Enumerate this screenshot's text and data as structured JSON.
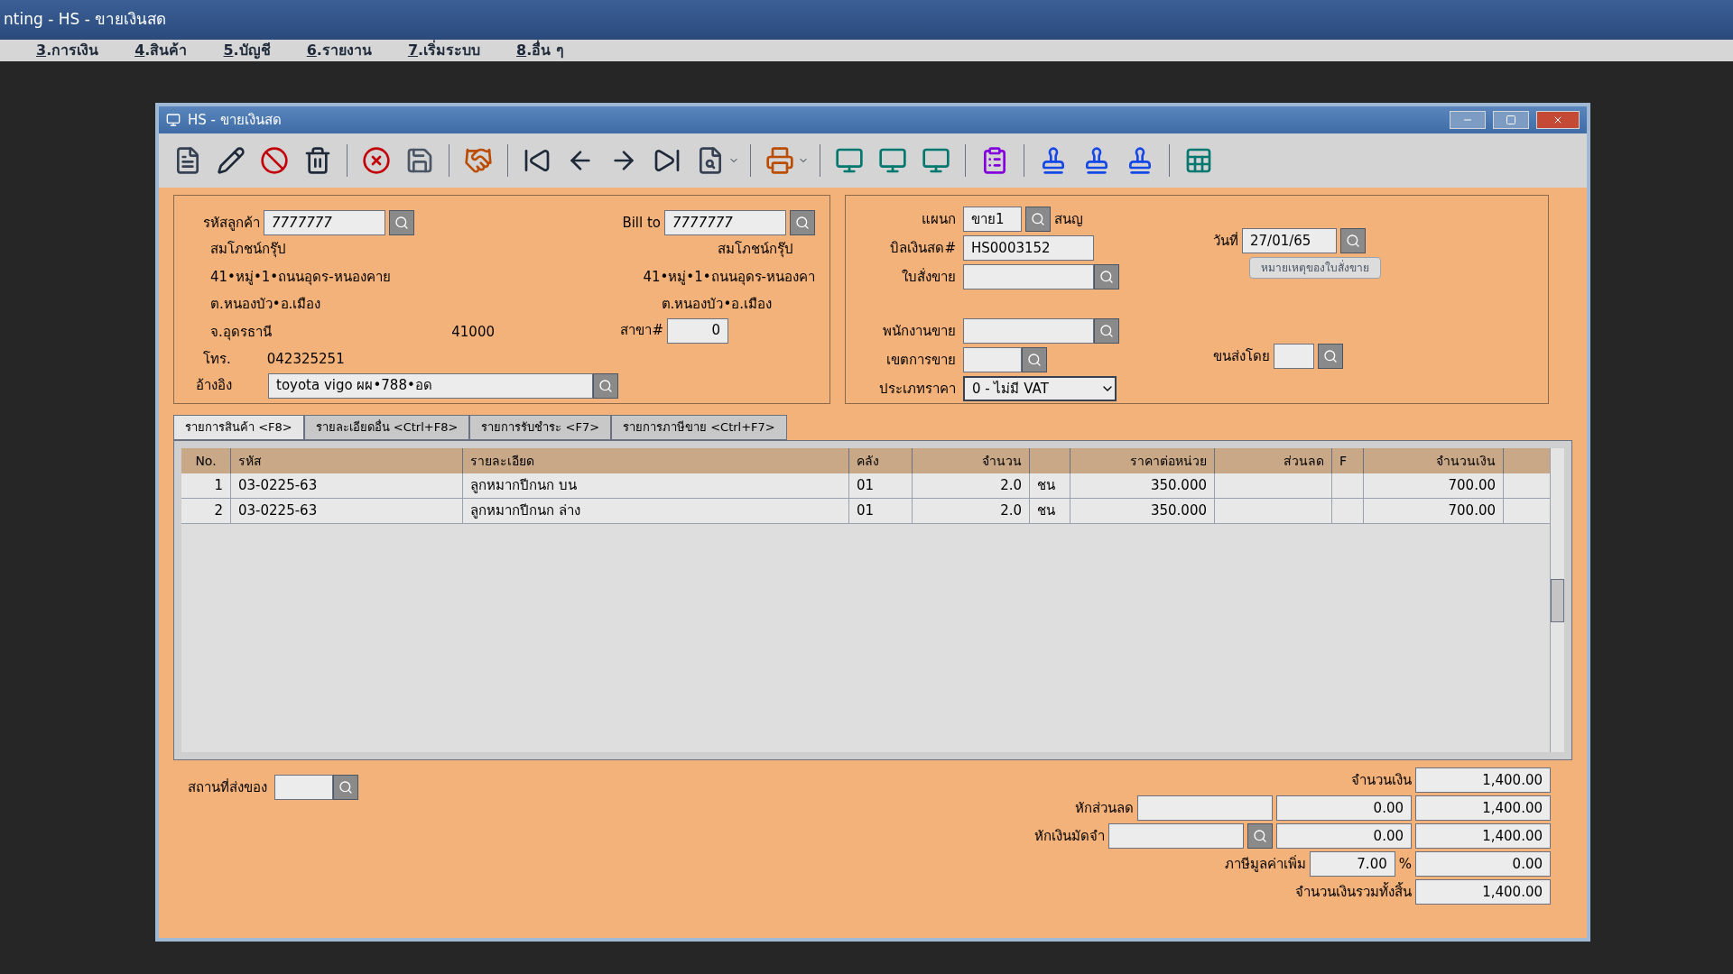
{
  "app_title": "nting - HS - ขายเงินสด",
  "menu": [
    {
      "num": "3",
      "label": ".การเงิน"
    },
    {
      "num": "4",
      "label": ".สินค้า"
    },
    {
      "num": "5",
      "label": ".บัญชี"
    },
    {
      "num": "6",
      "label": ".รายงาน"
    },
    {
      "num": "7",
      "label": ".เริ่มระบบ"
    },
    {
      "num": "8",
      "label": ".อื่น ๆ"
    }
  ],
  "window": {
    "title": "HS - ขายเงินสด"
  },
  "toolbar": [
    {
      "kind": "new"
    },
    {
      "kind": "edit"
    },
    {
      "kind": "void"
    },
    {
      "kind": "delete"
    },
    {
      "kind": "sep"
    },
    {
      "kind": "cancel"
    },
    {
      "kind": "save"
    },
    {
      "kind": "sep"
    },
    {
      "kind": "handshake"
    },
    {
      "kind": "sep"
    },
    {
      "kind": "first"
    },
    {
      "kind": "prev"
    },
    {
      "kind": "next"
    },
    {
      "kind": "last"
    },
    {
      "kind": "find"
    },
    {
      "kind": "caret"
    },
    {
      "kind": "sep"
    },
    {
      "kind": "print"
    },
    {
      "kind": "caret"
    },
    {
      "kind": "sep"
    },
    {
      "kind": "screen"
    },
    {
      "kind": "screen"
    },
    {
      "kind": "screen"
    },
    {
      "kind": "sep"
    },
    {
      "kind": "report"
    },
    {
      "kind": "sep"
    },
    {
      "kind": "stamp"
    },
    {
      "kind": "stamp"
    },
    {
      "kind": "stamp"
    },
    {
      "kind": "sep"
    },
    {
      "kind": "sheet"
    }
  ],
  "customer": {
    "code_label": "รหัสลูกค้า",
    "code": "7777777",
    "name": "สมโภชน์กรุ๊ป",
    "address1": "41•หมู่•1•ถนนอุดร-หนองคาย",
    "address2": "ต.หนองบัว•อ.เมือง",
    "province": "จ.อุดรธานี",
    "postcode": "41000",
    "phone_label": "โทร.",
    "phone": "042325251",
    "ref_label": "อ้างอิง",
    "ref": "toyota vigo ผผ•788•อด"
  },
  "bill_to": {
    "label": "Bill to",
    "code": "7777777",
    "name": "สมโภชน์กรุ๊ป",
    "address1": "41•หมู่•1•ถนนอุดร-หนองคา",
    "address2": "ต.หนองบัว•อ.เมือง",
    "branch_label": "สาขา#",
    "branch": "0"
  },
  "document": {
    "dept_label": "แผนก",
    "dept": "ขาย1",
    "dept_name": "สนญ",
    "bill_label": "บิลเงินสด#",
    "bill": "HS0003152",
    "order_label": "ใบสั่งขาย",
    "date_label": "วันที่",
    "date": "27/01/65",
    "note_button": "หมายเหตุของใบสั่งขาย",
    "sales_label": "พนักงานขาย",
    "area_label": "เขตการขาย",
    "ship_label": "ขนส่งโดย",
    "price_type_label": "ประเภทราคา",
    "price_type": "0 - ไม่มี VAT"
  },
  "tabs": [
    {
      "label": "รายการสินค้า <F8>",
      "selected": true
    },
    {
      "label": "รายละเอียดอื่น  <Ctrl+F8>",
      "selected": false
    },
    {
      "label": "รายการรับชำระ <F7>",
      "selected": false
    },
    {
      "label": "รายการภาษีขาย <Ctrl+F7>",
      "selected": false
    }
  ],
  "table": {
    "columns": [
      "No.",
      "รหัส",
      "รายละเอียด",
      "คลัง",
      "จำนวน",
      "",
      "ราคาต่อหน่วย",
      "ส่วนลด",
      "F",
      "จำนวนเงิน"
    ],
    "rows": [
      [
        "1",
        "03-0225-63",
        "ลูกหมากปีกนก บน",
        "01",
        "2.0",
        "ชน",
        "350.000",
        "",
        "",
        "700.00"
      ],
      [
        "2",
        "03-0225-63",
        "ลูกหมากปีกนก ล่าง",
        "01",
        "2.0",
        "ชน",
        "350.000",
        "",
        "",
        "700.00"
      ]
    ]
  },
  "footer": {
    "place_label": "สถานที่ส่งของ",
    "amount_label": "จำนวนเงิน",
    "amount": "1,400.00",
    "discount_label": "หักส่วนลด",
    "discount": "0.00",
    "after_discount": "1,400.00",
    "deposit_label": "หักเงินมัดจำ",
    "deposit": "0.00",
    "after_deposit": "1,400.00",
    "vat_label": "ภาษีมูลค่าเพิ่ม",
    "vat_rate": "7.00",
    "vat_unit": "%",
    "vat": "0.00",
    "total_label": "จำนวนเงินรวมทั้งสิ้น",
    "total": "1,400.00"
  }
}
